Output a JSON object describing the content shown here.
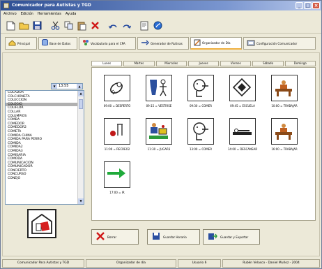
{
  "window": {
    "title": "Comunicador para Autistas y TGD",
    "minimize": "_",
    "maximize": "□",
    "close": "×"
  },
  "menu": [
    {
      "label": "Archivo"
    },
    {
      "label": "Edición"
    },
    {
      "label": "Herramientas"
    },
    {
      "label": "Ayuda"
    }
  ],
  "toolbar": {
    "icons": [
      "new-doc-icon",
      "open-folder-icon",
      "save-icon",
      "cut-icon",
      "copy-icon",
      "paste-icon",
      "delete-icon",
      "undo-icon",
      "redo-icon",
      "print-preview-icon",
      "help-icon"
    ]
  },
  "tabs": [
    {
      "label": "Principal",
      "icon": "house-icon"
    },
    {
      "label": "Base de Datos",
      "icon": "database-icon"
    },
    {
      "label": "Vocabulario para el CPA",
      "icon": "vocabulary-icon"
    },
    {
      "label": "Generador de Rutinas",
      "icon": "routine-icon"
    },
    {
      "label": "Organizador de Día",
      "icon": "organizer-icon",
      "active": true
    },
    {
      "label": "Configuración Comunicador",
      "icon": "config-icon"
    }
  ],
  "time_combo": {
    "value": "13:55"
  },
  "words": [
    "COLADOR",
    "COLCHONETA",
    "COLECCION",
    "COLEGIO",
    "COLIFLOR",
    "COLLAR",
    "COLUMPIOS",
    "COMBA",
    "COMEDOR",
    "COMEDOR2",
    "COMETA",
    "COMIDA CHINA",
    "COMIDA PARA PERRO",
    "COMIDA",
    "COMIDA2",
    "COMIDA3",
    "COMISARIA",
    "COMODA",
    "COMUNICACION",
    "COMUNICADOR",
    "CONCIERTO",
    "CONCURSO",
    "CONEJO"
  ],
  "selected_word_index": 3,
  "days": [
    {
      "label": "Lunes",
      "active": true
    },
    {
      "label": "Martes"
    },
    {
      "label": "Miercoles"
    },
    {
      "label": "Jueves"
    },
    {
      "label": "Viernes"
    },
    {
      "label": "Sábado"
    },
    {
      "label": "Domingo"
    }
  ],
  "schedule": [
    {
      "caption": "09:00 = DESPERTO",
      "icon": "wake-up-icon"
    },
    {
      "caption": "09:15 = VESTIRSE",
      "icon": "dress-icon"
    },
    {
      "caption": "09:30 = COMER",
      "icon": "eat-icon"
    },
    {
      "caption": "09:45 = ESCUELA",
      "icon": "school-icon"
    },
    {
      "caption": "10:00 = TRABAJAR",
      "icon": "work-icon"
    },
    {
      "caption": "11:00 = RECREO2",
      "icon": "recess-icon"
    },
    {
      "caption": "11:30 = JUGAR3",
      "icon": "play-icon"
    },
    {
      "caption": "13:00 = COMER",
      "icon": "eat-icon"
    },
    {
      "caption": "14:00 = DESCANSAR",
      "icon": "rest-icon"
    },
    {
      "caption": "16:00 = TRABAJAR",
      "icon": "work-icon"
    },
    {
      "caption": "17:00 = IR",
      "icon": "go-arrow-icon"
    }
  ],
  "actions": [
    {
      "label": "Borrar",
      "icon": "delete-x-icon"
    },
    {
      "label": "Guardar Horario",
      "icon": "save-icon"
    },
    {
      "label": "Guardar y Exportar",
      "icon": "export-icon"
    }
  ],
  "status": [
    "Comunicador Para Autistas y TGD",
    "Organizador de día",
    "Usuario 6",
    "Rubén Velasco - Daniel Muñoz - 2004"
  ],
  "colors": {
    "accent": "#f0b040",
    "titlebar": "#2e4f94",
    "selection": "#b0b0b0"
  }
}
